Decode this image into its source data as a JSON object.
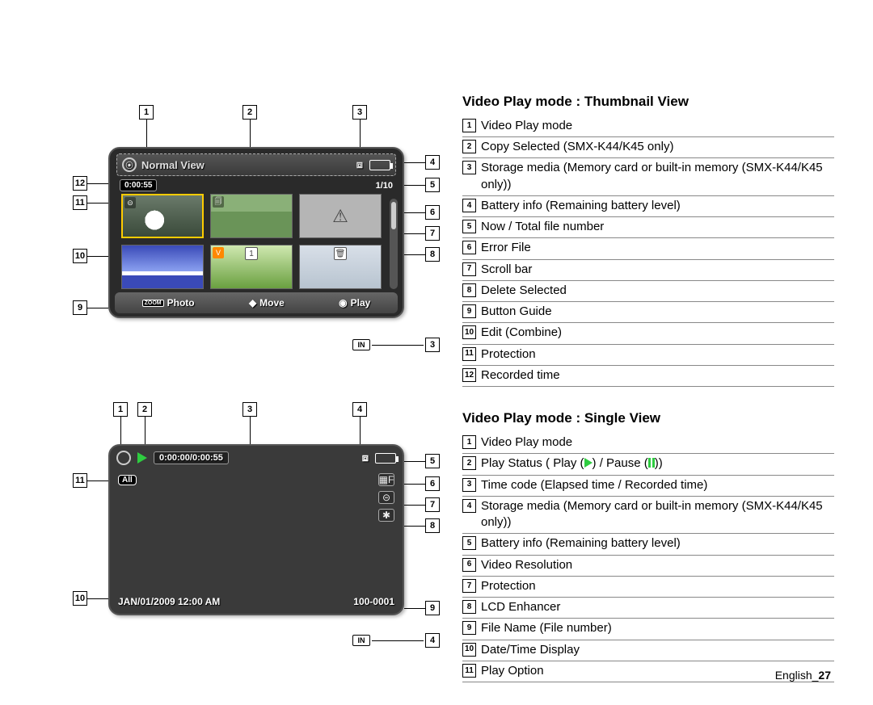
{
  "thumbnail_view": {
    "title": "Video Play mode : Thumbnail View",
    "screen": {
      "header": "Normal View",
      "recorded_time": "0:00:55",
      "file_counter": "1/10",
      "buttons": {
        "photo": "Photo",
        "move": "Move",
        "play": "Play",
        "zoom": "ZOOM"
      }
    },
    "legend": [
      "Video Play mode",
      "Copy Selected (SMX-K44/K45 only)",
      "Storage media (Memory card or built-in memory (SMX-K44/K45 only))",
      "Battery info (Remaining battery level)",
      "Now / Total file number",
      "Error File",
      "Scroll bar",
      "Delete Selected",
      "Button Guide",
      "Edit (Combine)",
      "Protection",
      "Recorded time"
    ],
    "in_label": "IN"
  },
  "single_view": {
    "title": "Video Play mode : Single View",
    "screen": {
      "timecode": "0:00:00/0:00:55",
      "play_option": "All",
      "datetime": "JAN/01/2009 12:00 AM",
      "filename": "100-0001"
    },
    "legend": [
      "Video Play mode",
      "Play Status ( Play ( ▶ ) / Pause ( ❚❚ ))",
      "Time code (Elapsed time / Recorded time)",
      "Storage media (Memory card or built-in memory (SMX-K44/K45 only))",
      "Battery info (Remaining battery level)",
      "Video Resolution",
      "Protection",
      "LCD Enhancer",
      "File Name (File number)",
      "Date/Time Display",
      "Play Option"
    ],
    "in_label": "IN"
  },
  "footer": {
    "lang": "English",
    "page": "27"
  }
}
